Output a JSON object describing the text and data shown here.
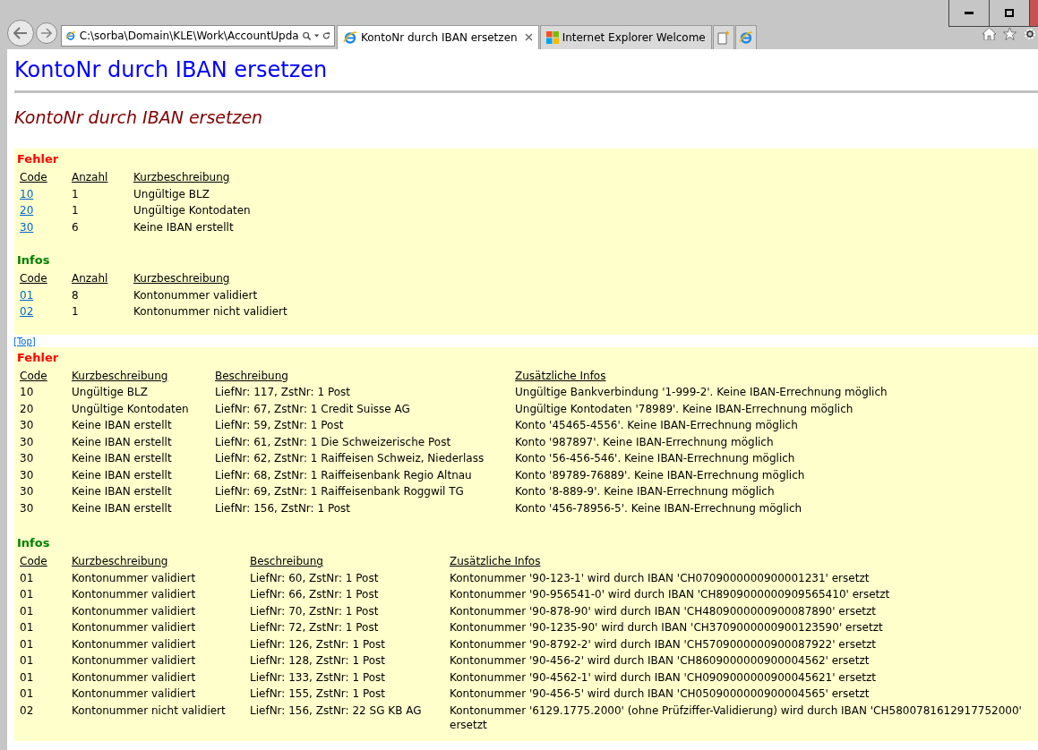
{
  "browser": {
    "address": "C:\\sorba\\Domain\\KLE\\Work\\AccountUpda",
    "tabs": [
      {
        "label": "KontoNr durch IBAN ersetzen",
        "selected": true,
        "closable": true
      },
      {
        "label": "Internet Explorer Welcome",
        "selected": false,
        "closable": false
      }
    ]
  },
  "page": {
    "title": "KontoNr durch IBAN ersetzen",
    "subtitle": "KontoNr durch IBAN ersetzen",
    "summary": [
      {
        "kind": "error",
        "heading": "Fehler",
        "columns": [
          "Code",
          "Anzahl",
          "Kurzbeschreibung"
        ],
        "rows": [
          [
            "10",
            "1",
            "Ungültige BLZ"
          ],
          [
            "20",
            "1",
            "Ungültige Kontodaten"
          ],
          [
            "30",
            "6",
            "Keine IBAN erstellt"
          ]
        ]
      },
      {
        "kind": "info",
        "heading": "Infos",
        "columns": [
          "Code",
          "Anzahl",
          "Kurzbeschreibung"
        ],
        "rows": [
          [
            "01",
            "8",
            "Kontonummer validiert"
          ],
          [
            "02",
            "1",
            "Kontonummer nicht validiert"
          ]
        ]
      }
    ],
    "top_link": "[Top]",
    "details": [
      {
        "kind": "error",
        "heading": "Fehler",
        "columns": [
          "Code",
          "Kurzbeschreibung",
          "Beschreibung",
          "Zusätzliche Infos"
        ],
        "rows": [
          [
            "10",
            "Ungültige BLZ",
            "LiefNr: 117, ZstNr: 1 Post",
            "Ungültige Bankverbindung '1-999-2'. Keine IBAN-Errechnung möglich"
          ],
          [
            "20",
            "Ungültige Kontodaten",
            "LiefNr: 67, ZstNr: 1 Credit Suisse AG",
            "Ungültige Kontodaten '78989'. Keine IBAN-Errechnung möglich"
          ],
          [
            "30",
            "Keine IBAN erstellt",
            "LiefNr: 59, ZstNr: 1 Post",
            "Konto '45465-4556'. Keine IBAN-Errechnung möglich"
          ],
          [
            "30",
            "Keine IBAN erstellt",
            "LiefNr: 61, ZstNr: 1 Die Schweizerische Post",
            "Konto '987897'. Keine IBAN-Errechnung möglich"
          ],
          [
            "30",
            "Keine IBAN erstellt",
            "LiefNr: 62, ZstNr: 1 Raiffeisen Schweiz, Niederlass",
            "Konto '56-456-546'. Keine IBAN-Errechnung möglich"
          ],
          [
            "30",
            "Keine IBAN erstellt",
            "LiefNr: 68, ZstNr: 1 Raiffeisenbank Regio Altnau",
            "Konto '89789-76889'. Keine IBAN-Errechnung möglich"
          ],
          [
            "30",
            "Keine IBAN erstellt",
            "LiefNr: 69, ZstNr: 1 Raiffeisenbank Roggwil TG",
            "Konto '8-889-9'. Keine IBAN-Errechnung möglich"
          ],
          [
            "30",
            "Keine IBAN erstellt",
            "LiefNr: 156, ZstNr: 1 Post",
            "Konto '456-78956-5'. Keine IBAN-Errechnung möglich"
          ]
        ]
      },
      {
        "kind": "info",
        "heading": "Infos",
        "columns": [
          "Code",
          "Kurzbeschreibung",
          "Beschreibung",
          "Zusätzliche Infos"
        ],
        "rows": [
          [
            "01",
            "Kontonummer validiert",
            "LiefNr: 60, ZstNr: 1 Post",
            "Kontonummer '90-123-1' wird durch IBAN 'CH0709000000900001231' ersetzt"
          ],
          [
            "01",
            "Kontonummer validiert",
            "LiefNr: 66, ZstNr: 1 Post",
            "Kontonummer '90-956541-0' wird durch IBAN 'CH8909000000909565410' ersetzt"
          ],
          [
            "01",
            "Kontonummer validiert",
            "LiefNr: 70, ZstNr: 1 Post",
            "Kontonummer '90-878-90' wird durch IBAN 'CH4809000000900087890' ersetzt"
          ],
          [
            "01",
            "Kontonummer validiert",
            "LiefNr: 72, ZstNr: 1 Post",
            "Kontonummer '90-1235-90' wird durch IBAN 'CH3709000000900123590' ersetzt"
          ],
          [
            "01",
            "Kontonummer validiert",
            "LiefNr: 126, ZstNr: 1 Post",
            "Kontonummer '90-8792-2' wird durch IBAN 'CH5709000000900087922' ersetzt"
          ],
          [
            "01",
            "Kontonummer validiert",
            "LiefNr: 128, ZstNr: 1 Post",
            "Kontonummer '90-456-2' wird durch IBAN 'CH8609000000900004562' ersetzt"
          ],
          [
            "01",
            "Kontonummer validiert",
            "LiefNr: 133, ZstNr: 1 Post",
            "Kontonummer '90-4562-1' wird durch IBAN 'CH0909000000900045621' ersetzt"
          ],
          [
            "01",
            "Kontonummer validiert",
            "LiefNr: 155, ZstNr: 1 Post",
            "Kontonummer '90-456-5' wird durch IBAN 'CH0509000000900004565' ersetzt"
          ],
          [
            "02",
            "Kontonummer nicht validiert",
            "LiefNr: 156, ZstNr: 22 SG KB AG",
            "Kontonummer '6129.1775.2000' (ohne Prüfziffer-Validierung) wird durch IBAN 'CH5800781612917752000' ersetzt"
          ]
        ]
      }
    ]
  }
}
